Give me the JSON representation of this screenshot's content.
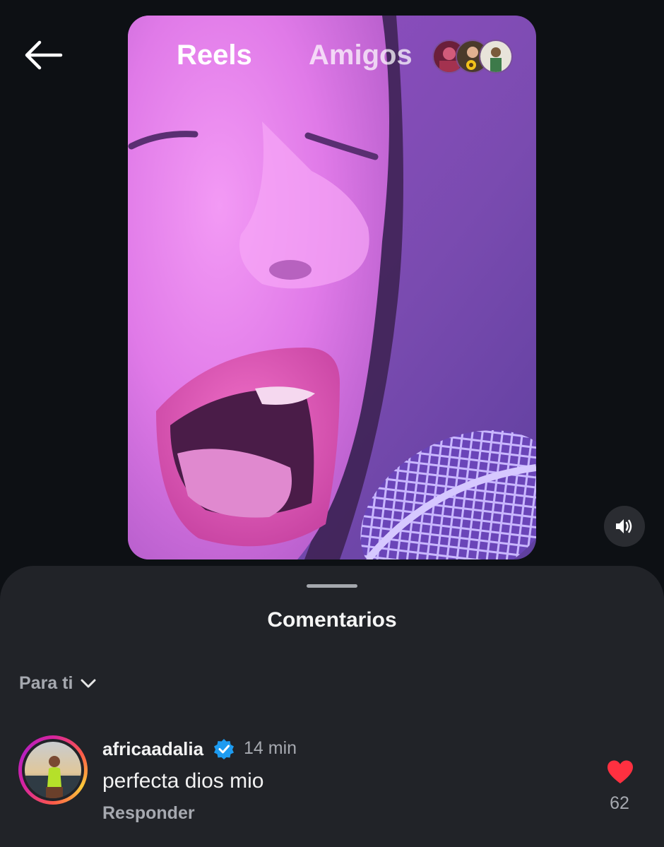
{
  "header": {
    "tabs": [
      {
        "label": "Reels",
        "active": true
      },
      {
        "label": "Amigos",
        "active": false
      }
    ]
  },
  "comments_sheet": {
    "title": "Comentarios",
    "sort_label": "Para ti",
    "comments": [
      {
        "username": "africaadalia",
        "verified": true,
        "time": "14 min",
        "text": "perfecta dios mio",
        "reply_label": "Responder",
        "likes": "62"
      }
    ]
  },
  "colors": {
    "background": "#0d1014",
    "sheet": "#212328",
    "muted_text": "#a6a9b0",
    "like_red": "#ff3040",
    "verified_blue": "#1d9bf0"
  },
  "icons": {
    "back": "arrow-left-icon",
    "sound": "speaker-icon",
    "sort": "chevron-down-icon",
    "verified": "verified-badge-icon",
    "like": "heart-icon"
  }
}
